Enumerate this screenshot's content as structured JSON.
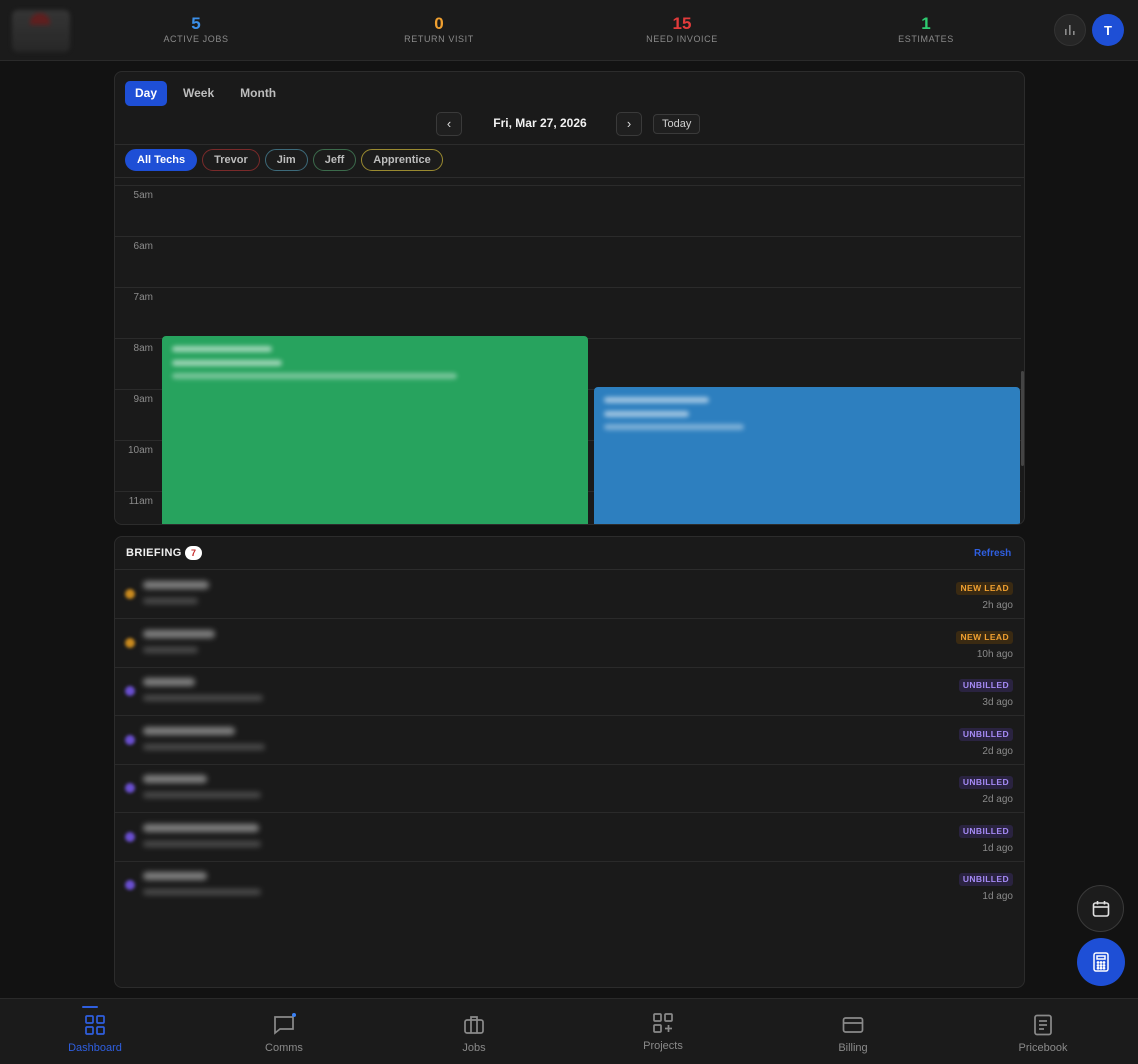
{
  "header": {
    "stats": [
      {
        "value": "5",
        "label": "ACTIVE JOBS",
        "color": "#3b8fe8"
      },
      {
        "value": "0",
        "label": "RETURN VISIT",
        "color": "#f0a030"
      },
      {
        "value": "15",
        "label": "NEED INVOICE",
        "color": "#e23b3b"
      },
      {
        "value": "1",
        "label": "ESTIMATES",
        "color": "#2ecc71"
      }
    ],
    "avatar_initial": "T"
  },
  "calendar": {
    "view_tabs": [
      "Day",
      "Week",
      "Month"
    ],
    "active_view": "Day",
    "prev_label": "‹",
    "next_label": "›",
    "date_label": "Fri, Mar 27, 2026",
    "today_label": "Today",
    "techs": [
      {
        "label": "All Techs",
        "color": "#1e4fd6"
      },
      {
        "label": "Trevor",
        "color": "#7a2a2a"
      },
      {
        "label": "Jim",
        "color": "#3d6a7a"
      },
      {
        "label": "Jeff",
        "color": "#3c6b4c"
      },
      {
        "label": "Apprentice",
        "color": "#9a8a30"
      }
    ],
    "hours": [
      "5am",
      "6am",
      "7am",
      "8am",
      "9am",
      "10am",
      "11am"
    ],
    "events": [
      {
        "color": "#27a35e"
      },
      {
        "color": "#2d7fbf"
      }
    ]
  },
  "briefing": {
    "title": "BRIEFING",
    "count": "7",
    "refresh_label": "Refresh",
    "items": [
      {
        "badge": "NEW LEAD",
        "type": "lead",
        "time": "2h ago",
        "dot": "#c98a1e"
      },
      {
        "badge": "NEW LEAD",
        "type": "lead",
        "time": "10h ago",
        "dot": "#c98a1e"
      },
      {
        "badge": "UNBILLED",
        "type": "unbilled",
        "time": "3d ago",
        "dot": "#6a4fd0"
      },
      {
        "badge": "UNBILLED",
        "type": "unbilled",
        "time": "2d ago",
        "dot": "#6a4fd0"
      },
      {
        "badge": "UNBILLED",
        "type": "unbilled",
        "time": "2d ago",
        "dot": "#6a4fd0"
      },
      {
        "badge": "UNBILLED",
        "type": "unbilled",
        "time": "1d ago",
        "dot": "#6a4fd0"
      },
      {
        "badge": "UNBILLED",
        "type": "unbilled",
        "time": "1d ago",
        "dot": "#6a4fd0"
      }
    ]
  },
  "bottom_nav": [
    {
      "label": "Dashboard",
      "icon": "grid-icon",
      "active": true
    },
    {
      "label": "Comms",
      "icon": "chat-icon",
      "active": false
    },
    {
      "label": "Jobs",
      "icon": "briefcase-icon",
      "active": false
    },
    {
      "label": "Projects",
      "icon": "projects-icon",
      "active": false
    },
    {
      "label": "Billing",
      "icon": "card-icon",
      "active": false
    },
    {
      "label": "Pricebook",
      "icon": "book-icon",
      "active": false
    }
  ]
}
